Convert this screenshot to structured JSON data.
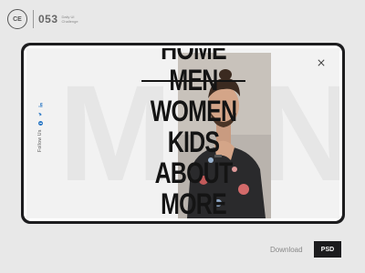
{
  "brand": {
    "logo_text": "CE",
    "number": "053",
    "subtitle_line1": "Daily UI",
    "subtitle_line2": "Challenge"
  },
  "background_word": "MEN",
  "sidebar": {
    "follow_label": "Follow Us",
    "social_icons": [
      "facebook-icon",
      "twitter-icon",
      "linkedin-icon"
    ]
  },
  "menu": {
    "items": [
      {
        "label": "HOME",
        "active": false
      },
      {
        "label": "MEN",
        "active": true
      },
      {
        "label": "WOMEN",
        "active": false
      },
      {
        "label": "KIDS",
        "active": false
      },
      {
        "label": "ABOUT",
        "active": false
      },
      {
        "label": "MORE",
        "active": false
      }
    ]
  },
  "footer": {
    "download_label": "Download",
    "psd_label": "PSD"
  },
  "colors": {
    "background": "#e8e8e8",
    "device": "#1c1c1e",
    "screen": "#f2f2f2",
    "menu_text": "#141414",
    "social": "#2b78c5"
  }
}
